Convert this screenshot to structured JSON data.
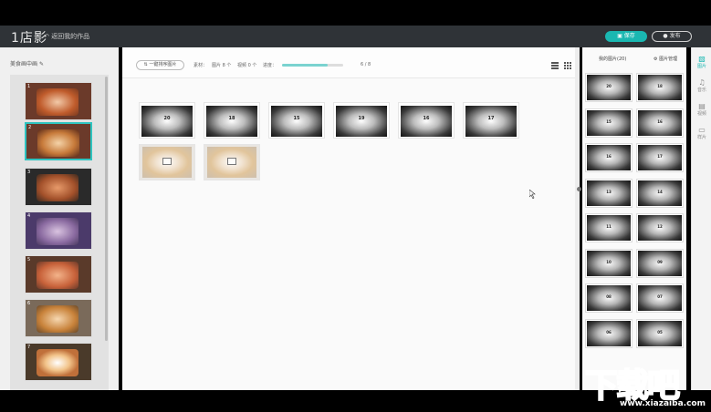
{
  "app": {
    "logo": "1店影",
    "back_label": "返回我的作品"
  },
  "header": {
    "save_label": "保存",
    "publish_label": "发布"
  },
  "left": {
    "title": "美食画中画",
    "slides": [
      "1",
      "2",
      "3",
      "4",
      "5",
      "6",
      "7"
    ]
  },
  "toolbar": {
    "sort_label": "一键排序图片",
    "material_label": "素材：",
    "pics_label": "图片 8 个",
    "videos_label": "视频 0 个",
    "progress_label": "进度：",
    "progress_text": "6 / 8",
    "progress_value": 0.75
  },
  "canvas": {
    "tiles": [
      {
        "label": "20",
        "type": "dark"
      },
      {
        "label": "18",
        "type": "dark"
      },
      {
        "label": "15",
        "type": "dark"
      },
      {
        "label": "19",
        "type": "dark"
      },
      {
        "label": "16",
        "type": "dark"
      },
      {
        "label": "17",
        "type": "dark"
      },
      {
        "label": "",
        "type": "photo"
      },
      {
        "label": "",
        "type": "photo"
      }
    ]
  },
  "right": {
    "title": "我的图片(20)",
    "manage_label": "图片管理",
    "tiles": [
      "20",
      "18",
      "15",
      "16",
      "16",
      "17",
      "13",
      "14",
      "11",
      "12",
      "10",
      "09",
      "08",
      "07",
      "06",
      "05"
    ]
  },
  "sidebar": {
    "items": [
      {
        "label": "图片",
        "icon": "image-icon"
      },
      {
        "label": "音乐",
        "icon": "music-icon"
      },
      {
        "label": "视频",
        "icon": "film-icon"
      },
      {
        "label": "样片",
        "icon": "monitor-icon"
      }
    ]
  },
  "watermark": {
    "text": "下载吧",
    "url": "www.xiazaiba.com"
  },
  "colors": {
    "accent": "#1ab7b1",
    "topbar": "#2f3337"
  }
}
